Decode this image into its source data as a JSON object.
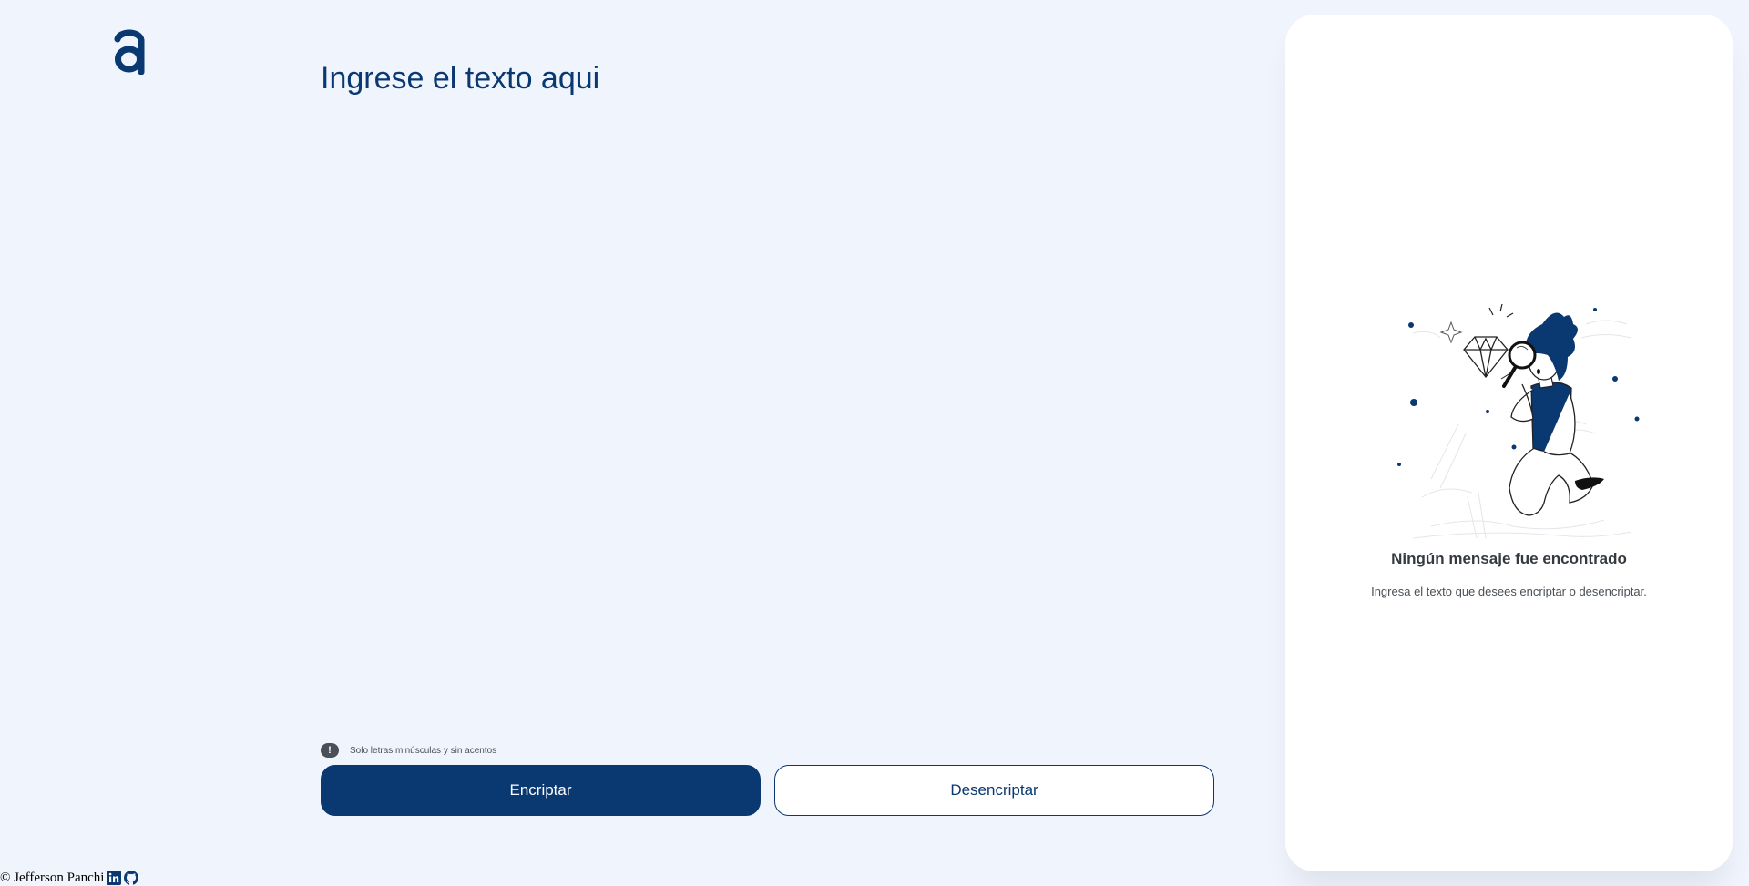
{
  "logo": {
    "icon": "alura-logo",
    "color": "#0a3871"
  },
  "input": {
    "placeholder": "Ingrese el texto aqui",
    "value": ""
  },
  "hint": {
    "icon": "exclamation-icon",
    "text": "Solo letras minúsculas y sin acentos"
  },
  "buttons": {
    "encrypt_label": "Encriptar",
    "decrypt_label": "Desencriptar"
  },
  "output_panel": {
    "illustration": "person-with-magnifying-glass-illustration",
    "empty_title": "Ningún mensaje fue encontrado",
    "empty_description": "Ingresa el texto que desees encriptar o desencriptar."
  },
  "footer": {
    "text": "© Jefferson Panchi",
    "links": [
      "linkedin-icon",
      "github-icon"
    ]
  },
  "colors": {
    "background": "#eff4fd",
    "primary": "#0a3871",
    "panel": "#ffffff",
    "text_dark": "#343a40",
    "text_muted": "#495057"
  }
}
